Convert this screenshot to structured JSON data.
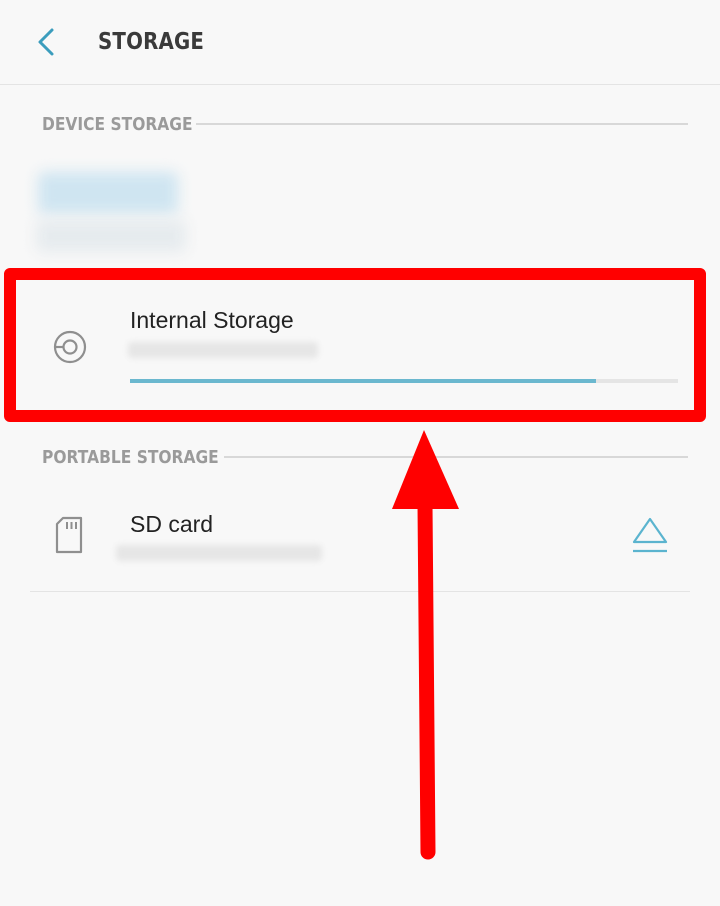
{
  "header": {
    "title": "STORAGE"
  },
  "sections": {
    "device": {
      "label": "DEVICE STORAGE"
    },
    "portable": {
      "label": "PORTABLE STORAGE"
    }
  },
  "internal_storage": {
    "title": "Internal Storage",
    "used_fraction": 0.85
  },
  "sd_card": {
    "title": "SD card"
  },
  "colors": {
    "accent": "#6bb8cf",
    "annotation": "#ff0000"
  },
  "icons": {
    "back": "back-arrow-icon",
    "internal": "storage-chart-icon",
    "sd": "sd-card-icon",
    "eject": "eject-icon"
  }
}
